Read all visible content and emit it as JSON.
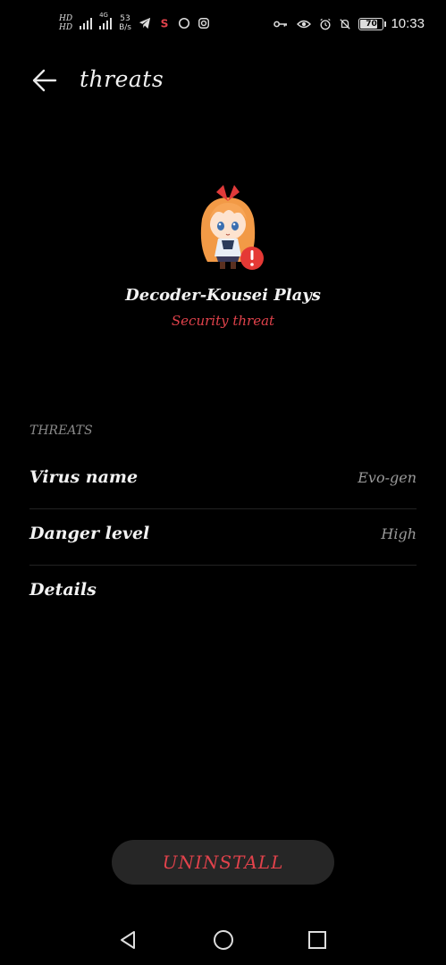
{
  "status_bar": {
    "hd_top": "HD",
    "hd_bottom": "HD",
    "network_type": "4G",
    "speed_value": "53",
    "speed_unit": "B/s",
    "battery": "70",
    "time": "10:33",
    "icons": [
      "signal-icon",
      "telegram-icon",
      "app-s-icon",
      "circle-icon",
      "instagram-icon",
      "key-icon",
      "eye-icon",
      "alarm-icon",
      "mute-icon",
      "battery-icon"
    ]
  },
  "header": {
    "title": "threats"
  },
  "app": {
    "name": "Decoder-Kousei Plays",
    "status": "Security threat",
    "status_color": "#e0424b"
  },
  "section": {
    "label": "THREATS"
  },
  "rows": [
    {
      "label": "Virus name",
      "value": "Evo-gen"
    },
    {
      "label": "Danger level",
      "value": "High"
    },
    {
      "label": "Details",
      "value": ""
    }
  ],
  "actions": {
    "uninstall": "UNINSTALL"
  },
  "nav": {
    "icons": [
      "back-nav-icon",
      "home-nav-icon",
      "recents-nav-icon"
    ]
  }
}
